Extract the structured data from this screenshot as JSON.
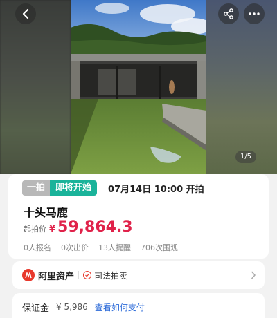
{
  "media": {
    "counter": "1/5"
  },
  "auction": {
    "tag_primary": "一拍",
    "tag_status": "即将开始",
    "start_time": "07月14日 10:00 开拍",
    "title": "十头马鹿",
    "price_label": "起拍价",
    "currency": "¥",
    "price": "59,864.3",
    "stats": {
      "signups": "0人报名",
      "bids": "0次出价",
      "reminders": "13人提醒",
      "views": "706次围观"
    }
  },
  "seller": {
    "brand": "阿里资产",
    "channel": "司法拍卖"
  },
  "deposit": {
    "label": "保证金",
    "value": "¥ 5,986",
    "link": "查看如何支付"
  },
  "colors": {
    "accent_teal": "#1ab39a",
    "price_red": "#e0224a",
    "brand_red": "#e8382c",
    "link_blue": "#2b6ad8"
  },
  "icons": [
    "back-arrow-icon",
    "share-icon",
    "more-dots-icon",
    "ali-assets-logo-icon",
    "judicial-check-icon",
    "chevron-right-icon"
  ]
}
